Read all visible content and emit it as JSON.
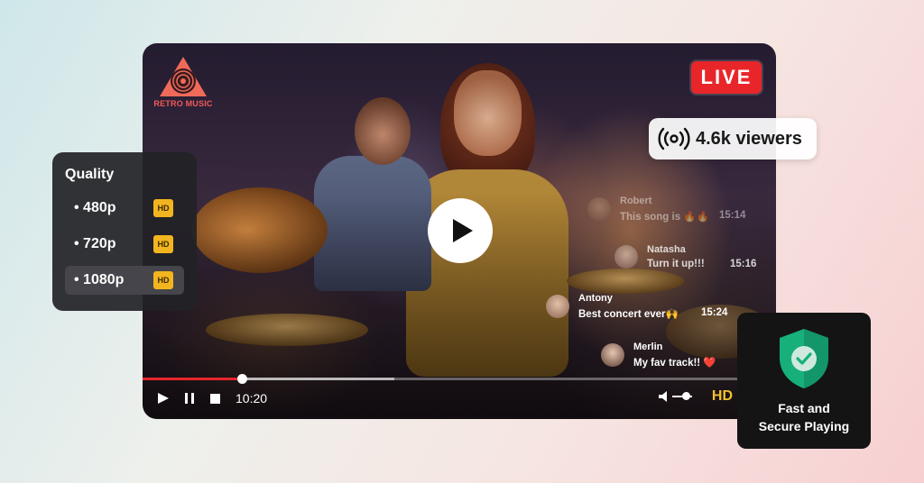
{
  "player": {
    "logo_text": "RETRO MUSIC",
    "live_label": "LIVE",
    "elapsed_time": "10:20",
    "progress": 0.157,
    "buffered": 0.24,
    "hd_label": "HD",
    "volume": 0.7
  },
  "viewers": {
    "label": "4.6k viewers",
    "icon": "broadcast-icon"
  },
  "chat": {
    "messages": [
      {
        "name": "Robert",
        "text": "This song is 🔥🔥",
        "time": "15:14"
      },
      {
        "name": "Natasha",
        "text": "Turn it up!!!",
        "time": "15:16"
      },
      {
        "name": "Antony",
        "text": "Best concert ever🙌",
        "time": "15:24"
      },
      {
        "name": "Merlin",
        "text": "My fav track!! ❤️",
        "time": ""
      }
    ]
  },
  "quality": {
    "title": "Quality",
    "options": [
      {
        "label": "• 480p",
        "badge": "HD",
        "selected": false
      },
      {
        "label": "• 720p",
        "badge": "HD",
        "selected": false
      },
      {
        "label": "• 1080p",
        "badge": "HD",
        "selected": true
      }
    ]
  },
  "secure": {
    "line1": "Fast and",
    "line2": "Secure Playing",
    "icon": "shield-check-icon"
  },
  "colors": {
    "live_red": "#e8262a",
    "hd_yellow": "#f2b51f",
    "shield_green": "#18b07a"
  }
}
